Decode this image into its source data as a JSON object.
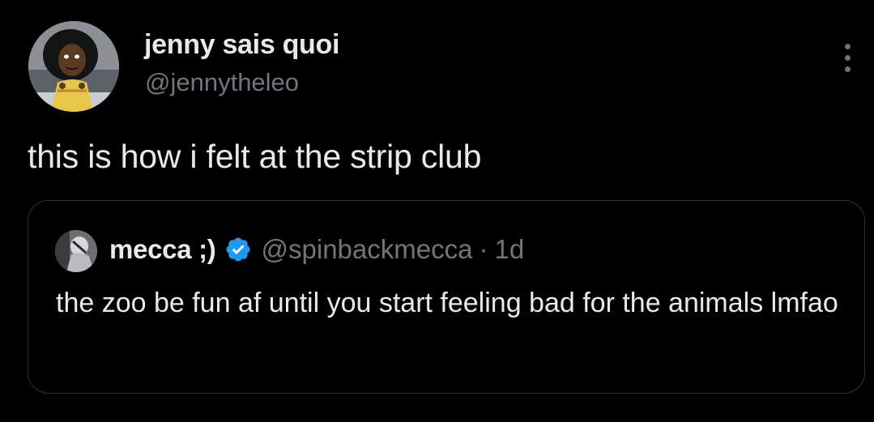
{
  "tweet": {
    "author": {
      "display_name": "jenny sais quoi",
      "handle": "@jennytheleo",
      "avatar_icon": "cartoon-avatar"
    },
    "more_icon": "more-vertical-icon",
    "text": "this is how i felt at the strip club"
  },
  "quote": {
    "author": {
      "display_name": "mecca ;)",
      "handle": "@spinbackmecca",
      "separator": "·",
      "time": "1d",
      "verified": true,
      "verified_icon": "verified-badge-icon",
      "avatar_icon": "photo-avatar"
    },
    "text": "the zoo be fun af until you start feeling bad for the animals lmfao"
  },
  "colors": {
    "background": "#000000",
    "primary_text": "#e7e9ea",
    "secondary_text": "#71767b",
    "border": "#2f3336",
    "verified_blue": "#1d9bf0"
  }
}
